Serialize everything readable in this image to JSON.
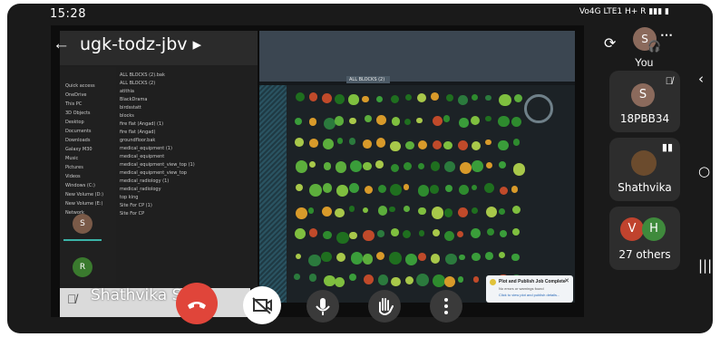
{
  "status_bar": {
    "time": "15:28",
    "network_label": "Vo4G LTE1",
    "network_label_2": "H+ R"
  },
  "meeting": {
    "title": "ugk-todz-jbv",
    "back_icon": "arrow-left-icon",
    "presenter_name": "Shathvika S...h",
    "self_label": "You"
  },
  "participants": [
    {
      "initial": "S",
      "name": "18PBB34",
      "color": "#8b6a5c"
    },
    {
      "initial": "",
      "name": "Shathvika",
      "color": "#6b4b2d"
    },
    {
      "initial_1": "V",
      "initial_2": "H",
      "name": "27 others",
      "color_1": "#c0432e",
      "color_2": "#3f8a3c"
    }
  ],
  "thumbnails": [
    {
      "initial": "S",
      "color": "#7a5a48"
    },
    {
      "initial": "R",
      "color": "#3a7a2e"
    }
  ],
  "shared_screen": {
    "explorer_nav": [
      "Quick access",
      "OneDrive",
      "This PC",
      "3D Objects",
      "Desktop",
      "Documents",
      "Downloads",
      "Galaxy M30",
      "Music",
      "Pictures",
      "Videos",
      "Windows (C:)",
      "New Volume (D:)",
      "New Volume (E:)",
      "Network"
    ],
    "explorer_files": [
      "ALL BLOCKS (2).bak",
      "ALL BLOCKS (2)",
      "atithia",
      "BlackDrama",
      "birdsstatt",
      "blocks",
      "fire flat (Angad) (1)",
      "fire flat (Angad)",
      "groundfloor.bak",
      "medical_equipment (1)",
      "medical_equipment",
      "medical_equipment_view_top (1)",
      "medical_equipment_view_top",
      "medical_radiology (1)",
      "medical_radiology",
      "top king",
      "Site For CP (1)",
      "Site For CP"
    ],
    "cad_tab": "ALL BLOCKS (2)",
    "notification_title": "Plot and Publish Job Complete",
    "notification_body": "No errors or warnings found",
    "notification_link": "Click to view plot and publish details..."
  },
  "colors": {
    "end_call": "#e0453a",
    "control_bg": "#ffffff",
    "tile_bg": "#2d2d2d"
  }
}
